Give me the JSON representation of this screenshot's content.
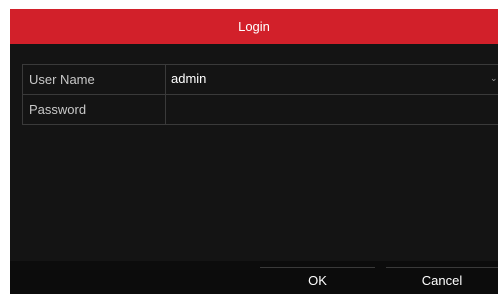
{
  "dialog": {
    "title": "Login"
  },
  "form": {
    "user_name_label": "User Name",
    "user_name_value": "admin",
    "password_label": "Password",
    "password_value": ""
  },
  "buttons": {
    "ok_label": "OK",
    "cancel_label": "Cancel"
  },
  "colors": {
    "titlebar": "#d2202a",
    "dialog_background": "#141414"
  },
  "icons": {
    "user_dropdown": "chevron-down-icon"
  }
}
